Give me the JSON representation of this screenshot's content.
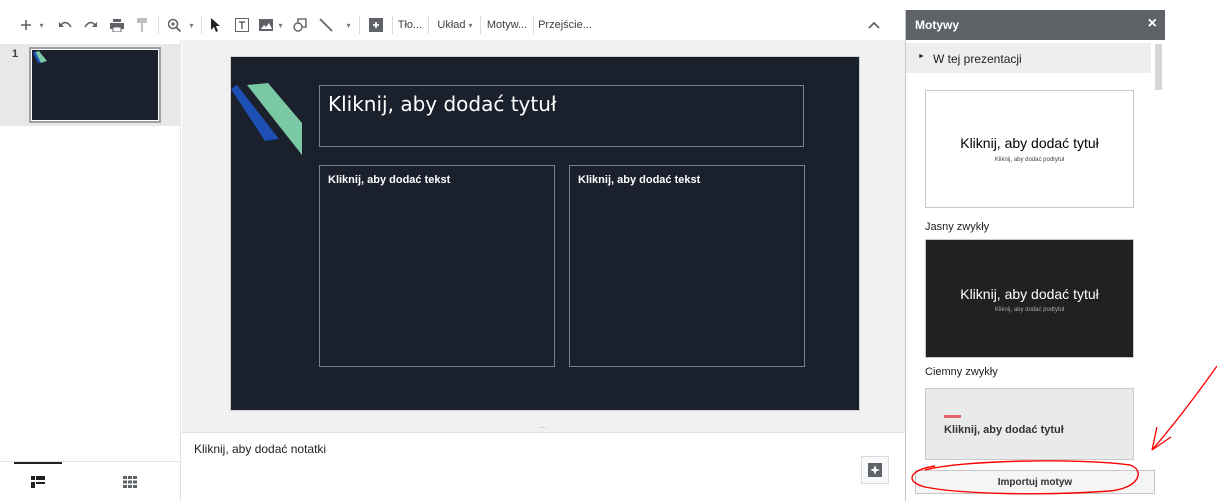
{
  "toolbar": {
    "background_label": "Tło...",
    "layout_label": "Układ",
    "theme_label": "Motyw...",
    "transition_label": "Przejście..."
  },
  "filmstrip": {
    "slides": [
      {
        "number": "1"
      }
    ]
  },
  "slide": {
    "title_placeholder": "Kliknij, aby dodać tytuł",
    "left_body_placeholder": "Kliknij, aby dodać tekst",
    "right_body_placeholder": "Kliknij, aby dodać tekst",
    "background_color": "#1a202c",
    "accent_colors": [
      "#7bc8a4",
      "#1e4fb4"
    ]
  },
  "notes": {
    "placeholder": "Kliknij, aby dodać notatki"
  },
  "themes_panel": {
    "title": "Motywy",
    "close_symbol": "×",
    "section_label": "W tej prezentacji",
    "themes": [
      {
        "name": "Jasny zwykły",
        "preview_title": "Kliknij, aby dodać tytuł",
        "preview_subtitle": "Kliknij, aby dodać podtytuł",
        "background": "#ffffff",
        "text_color": "#000000"
      },
      {
        "name": "Ciemny zwykły",
        "preview_title": "Kliknij, aby dodać tytuł",
        "preview_subtitle": "Kliknij, aby dodać podtytuł",
        "background": "#212121",
        "text_color": "#ffffff"
      },
      {
        "name": "",
        "preview_title": "Kliknij, aby dodać tytuł",
        "preview_subtitle": "",
        "background": "#e8eaeb",
        "text_color": "#333333",
        "accent": "#e06666"
      }
    ],
    "import_button_label": "Importuj motyw"
  },
  "annotation_color": "#ff0000"
}
